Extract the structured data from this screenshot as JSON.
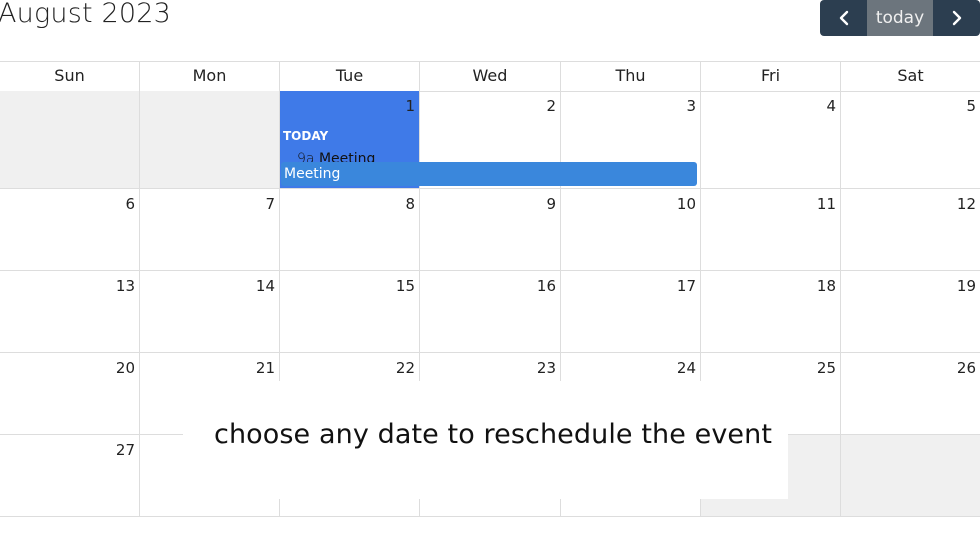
{
  "header": {
    "title": "August 2023",
    "prev_icon": "chevron-left-icon",
    "today_label": "today",
    "next_icon": "chevron-right-icon"
  },
  "weekdays": [
    "Sun",
    "Mon",
    "Tue",
    "Wed",
    "Thu",
    "Fri",
    "Sat"
  ],
  "weeks": [
    [
      "",
      "",
      "1",
      "2",
      "3",
      "4",
      "5"
    ],
    [
      "6",
      "7",
      "8",
      "9",
      "10",
      "11",
      "12"
    ],
    [
      "13",
      "14",
      "15",
      "16",
      "17",
      "18",
      "19"
    ],
    [
      "20",
      "21",
      "22",
      "23",
      "24",
      "25",
      "26"
    ],
    [
      "27",
      "",
      "",
      "",
      "",
      "",
      ""
    ]
  ],
  "today_badge": "TODAY",
  "today_event": {
    "time": "9a",
    "title": "Meeting"
  },
  "multi_day_event": {
    "title": "Meeting"
  },
  "overlay_message": "choose any date to reschedule the event",
  "colors": {
    "today_bg": "#3f7ae8",
    "event_bar": "#3a87dc",
    "button_dark": "#2c3e50",
    "button_today": "#6c757d",
    "other_month_bg": "#f0f0f0"
  }
}
